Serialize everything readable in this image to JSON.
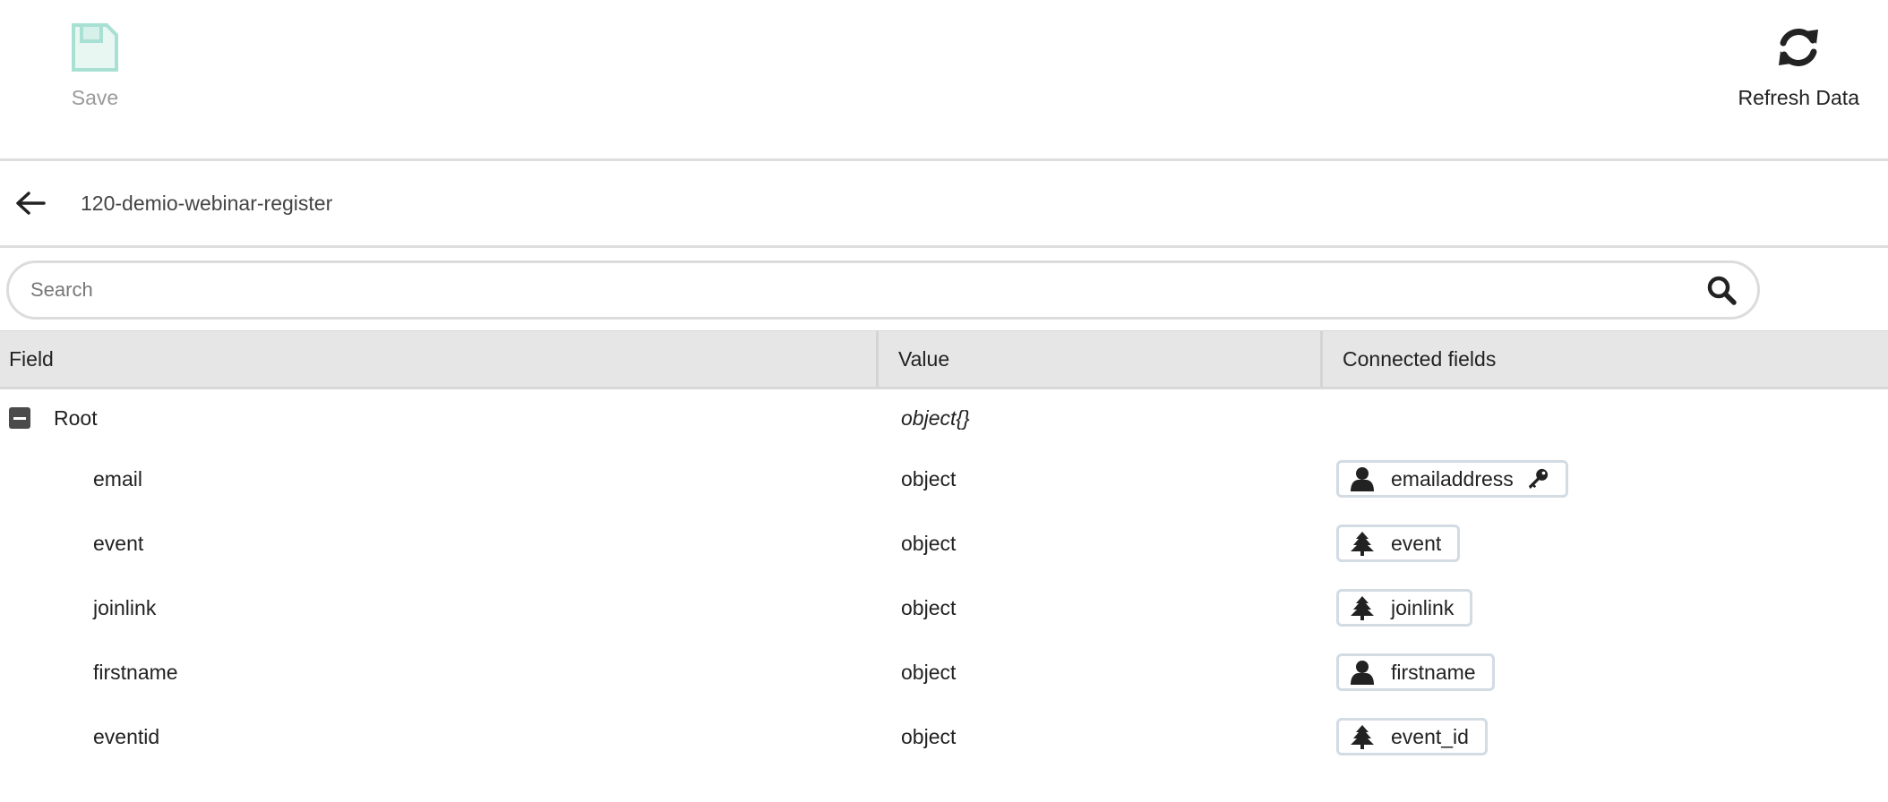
{
  "toolbar": {
    "save_label": "Save",
    "refresh_label": "Refresh Data"
  },
  "breadcrumb": {
    "title": "120-demio-webinar-register"
  },
  "search": {
    "placeholder": "Search"
  },
  "table": {
    "headers": {
      "field": "Field",
      "value": "Value",
      "connected": "Connected fields"
    },
    "root": {
      "field": "Root",
      "value": "object{}"
    },
    "rows": [
      {
        "field": "email",
        "value": "object",
        "chip_label": "emailaddress",
        "chip_icon": "person-icon",
        "has_key": true
      },
      {
        "field": "event",
        "value": "object",
        "chip_label": "event",
        "chip_icon": "tree-icon",
        "has_key": false
      },
      {
        "field": "joinlink",
        "value": "object",
        "chip_label": "joinlink",
        "chip_icon": "tree-icon",
        "has_key": false
      },
      {
        "field": "firstname",
        "value": "object",
        "chip_label": "firstname",
        "chip_icon": "person-icon",
        "has_key": false
      },
      {
        "field": "eventid",
        "value": "object",
        "chip_label": "event_id",
        "chip_icon": "tree-icon",
        "has_key": false
      }
    ]
  },
  "colors": {
    "save_icon": "#a8e0d4",
    "chip_border": "#d3dbe3",
    "header_bg": "#e6e6e6"
  }
}
